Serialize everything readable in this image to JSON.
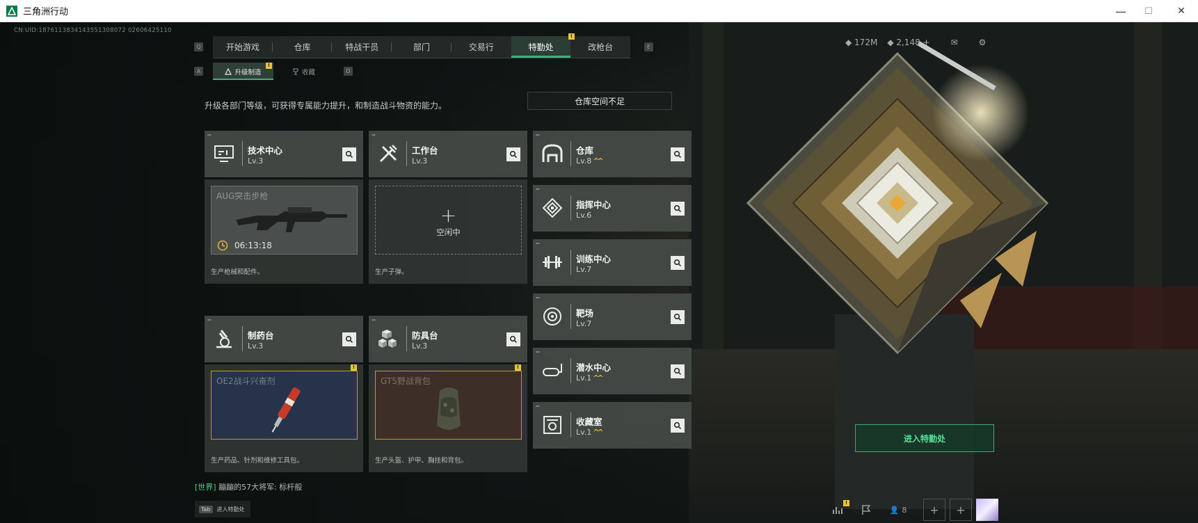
{
  "window": {
    "title": "三角洲行动",
    "minimize": "—",
    "maximize": "☐",
    "close": "✕"
  },
  "uid": "CN:UID:1876113834143551308072 02606425110",
  "tabs": [
    {
      "label": "开始游戏"
    },
    {
      "label": "仓库"
    },
    {
      "label": "特战干员"
    },
    {
      "label": "部门"
    },
    {
      "label": "交易行"
    },
    {
      "label": "特勤处"
    },
    {
      "label": "改枪台"
    }
  ],
  "tab_keys": {
    "left": "Q",
    "right": "E"
  },
  "subtabs": [
    {
      "label": "升级制造"
    },
    {
      "label": "收藏"
    }
  ],
  "subtab_keys": {
    "left": "A",
    "right": "D"
  },
  "badge": "!",
  "description": "升级各部门等级，可获得专属能力提升，和制造战斗物资的能力。",
  "warning": "仓库空间不足",
  "stats": {
    "currency1": "172M",
    "currency2": "2,148",
    "plus": "+"
  },
  "facilities": {
    "tech": {
      "name": "技术中心",
      "level": "Lv.3",
      "footer": "生产枪械和配件。",
      "item": "AUG突击步枪",
      "timer": "06:13:18"
    },
    "workbench": {
      "name": "工作台",
      "level": "Lv.3",
      "footer": "生产子弹。",
      "idle": "空闲中",
      "plus": "+"
    },
    "warehouse": {
      "name": "仓库",
      "level": "Lv.8",
      "up": "^^"
    },
    "command": {
      "name": "指挥中心",
      "level": "Lv.6"
    },
    "training": {
      "name": "训练中心",
      "level": "Lv.7"
    },
    "pharmacy": {
      "name": "制药台",
      "level": "Lv.3",
      "footer": "生产药品、针剂和维修工具包。",
      "item": "OE2战斗兴奋剂"
    },
    "armor": {
      "name": "防具台",
      "level": "Lv.3",
      "footer": "生产头盔、护甲、胸挂和背包。",
      "item": "GT5野战背包"
    },
    "range": {
      "name": "靶场",
      "level": "Lv.7"
    },
    "diving": {
      "name": "潜水中心",
      "level": "Lv.1",
      "up": "^^"
    },
    "collection": {
      "name": "收藏室",
      "level": "Lv.1",
      "up": "^^"
    }
  },
  "enter_button": "进入特勤处",
  "chat": {
    "channel": "[世界]",
    "message": "蹦蹦的57大将军: 标杆般"
  },
  "tab_hint": {
    "key": "Tab",
    "text": "进入特勤处"
  },
  "bottom": {
    "friends_count": "8"
  },
  "colors": {
    "accent": "#3fb07a",
    "badge": "#e8c43a",
    "card": "#464b48"
  }
}
